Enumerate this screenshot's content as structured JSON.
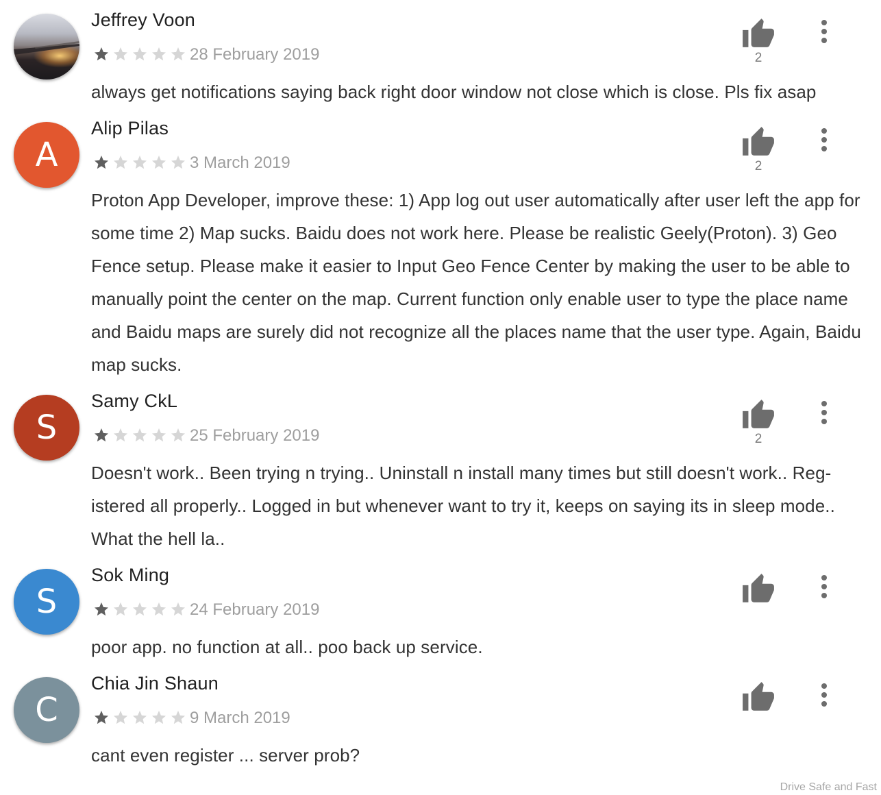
{
  "reviews": [
    {
      "name": "Jeffrey Voon",
      "avatar_letter": "",
      "avatar_color": "",
      "rating": 1,
      "date": "28 February 2019",
      "likes": "2",
      "text": "always get notifications saying back right door window not close which is close. Pls fix asap"
    },
    {
      "name": "Alip Pilas",
      "avatar_letter": "A",
      "avatar_color": "#e2572f",
      "rating": 1,
      "date": "3 March 2019",
      "likes": "2",
      "text": "Proton App Developer, improve these: 1) App log out user automatically after user left the app for some time 2) Map sucks. Baidu does not work here. Please be realistic Geely(Pro­ton). 3) Geo Fence setup. Please make it easier to Input Geo Fence Center by making the user to be able to manually point the center on the map. Current function only enable user to type the place name and Baidu maps are surely did not recognize all the places name that the user type. Again, Baidu map sucks."
    },
    {
      "name": "Samy CkL",
      "avatar_letter": "S",
      "avatar_color": "#b53d21",
      "rating": 1,
      "date": "25 February 2019",
      "likes": "2",
      "text": "Doesn't work.. Been trying n trying.. Uninstall n install many times but still doesn't work.. Reg­istered all properly.. Logged in but whenever want to try it, keeps on saying its in sleep mode.. What the hell la.."
    },
    {
      "name": "Sok Ming",
      "avatar_letter": "S",
      "avatar_color": "#3a89d0",
      "rating": 1,
      "date": "24 February 2019",
      "likes": "",
      "text": "poor app. no function at all.. poo back up service."
    },
    {
      "name": "Chia Jin Shaun",
      "avatar_letter": "C",
      "avatar_color": "#7b919c",
      "rating": 1,
      "date": "9 March 2019",
      "likes": "",
      "text": "cant even register ... server prob?"
    }
  ],
  "icons": {
    "helpful": "thumbs-up-icon",
    "more": "more-vertical-icon",
    "star": "star-icon"
  },
  "colors": {
    "star_filled": "#5f5f5f",
    "star_empty": "#d6d6d6",
    "icon": "#6d6d6d"
  },
  "watermark": "Drive Safe and Fast"
}
